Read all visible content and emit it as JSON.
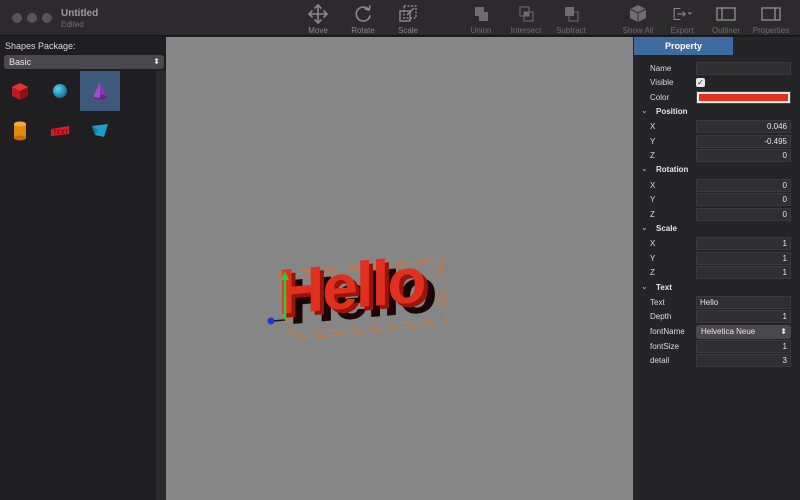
{
  "window": {
    "title": "Untitled",
    "subtitle": "Edited"
  },
  "toolbar": {
    "move": "Move",
    "rotate": "Rotate",
    "scale": "Scale",
    "union": "Union",
    "intersect": "Intersect",
    "subtract": "Subtract",
    "show_all": "Show All",
    "export": "Export",
    "outliner": "Outliner",
    "properties": "Properties"
  },
  "shapes_panel": {
    "label": "Shapes Package:",
    "package": "Basic",
    "shapes": [
      "cube",
      "sphere",
      "cone",
      "cylinder",
      "text",
      "plane"
    ],
    "selected": "cone"
  },
  "viewport": {
    "text_object": "Hello"
  },
  "property_panel": {
    "tab": "Property",
    "name_label": "Name",
    "name_value": "",
    "visible_label": "Visible",
    "visible_checked": "✓",
    "color_label": "Color",
    "color_value": "#e0301e",
    "position": {
      "header": "Position",
      "x_label": "X",
      "x": "0.046",
      "y_label": "Y",
      "y": "-0.495",
      "z_label": "Z",
      "z": "0"
    },
    "rotation": {
      "header": "Rotation",
      "x_label": "X",
      "x": "0",
      "y_label": "Y",
      "y": "0",
      "z_label": "Z",
      "z": "0"
    },
    "scale": {
      "header": "Scale",
      "x_label": "X",
      "x": "1",
      "y_label": "Y",
      "y": "1",
      "z_label": "Z",
      "z": "1"
    },
    "text": {
      "header": "Text",
      "text_label": "Text",
      "text": "Hello",
      "depth_label": "Depth",
      "depth": "1",
      "font_label": "fontName",
      "font": "Helvetica Neue",
      "size_label": "fontSize",
      "size": "1",
      "detail_label": "detail",
      "detail": "3"
    }
  },
  "colors": {
    "accent": "#3f6aa0",
    "viewport_bg": "#868686",
    "object": "#e0301e"
  }
}
